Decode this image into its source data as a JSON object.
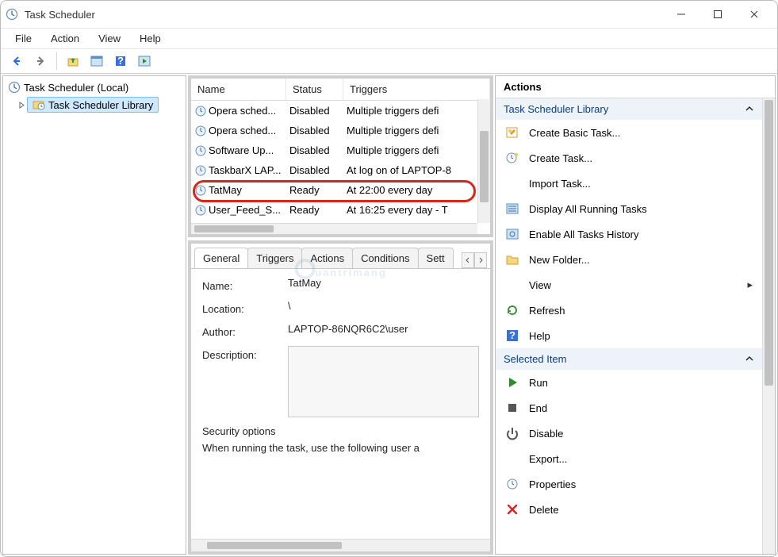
{
  "window": {
    "title": "Task Scheduler"
  },
  "menubar": {
    "file": "File",
    "action": "Action",
    "view": "View",
    "help": "Help"
  },
  "tree": {
    "root": "Task Scheduler (Local)",
    "library": "Task Scheduler Library"
  },
  "tasks": {
    "columns": {
      "name": "Name",
      "status": "Status",
      "triggers": "Triggers"
    },
    "rows": [
      {
        "name": "Opera sched...",
        "status": "Disabled",
        "triggers": "Multiple triggers defi"
      },
      {
        "name": "Opera sched...",
        "status": "Disabled",
        "triggers": "Multiple triggers defi"
      },
      {
        "name": "Software Up...",
        "status": "Disabled",
        "triggers": "Multiple triggers defi"
      },
      {
        "name": "TaskbarX LAP...",
        "status": "Disabled",
        "triggers": "At log on of LAPTOP-8"
      },
      {
        "name": "TatMay",
        "status": "Ready",
        "triggers": "At 22:00 every day"
      },
      {
        "name": "User_Feed_S...",
        "status": "Ready",
        "triggers": "At 16:25 every day - T"
      }
    ]
  },
  "details": {
    "tabs": {
      "general": "General",
      "triggers": "Triggers",
      "actions": "Actions",
      "conditions": "Conditions",
      "settings": "Sett"
    },
    "labels": {
      "name": "Name:",
      "location": "Location:",
      "author": "Author:",
      "description": "Description:"
    },
    "values": {
      "name": "TatMay",
      "location": "\\",
      "author": "LAPTOP-86NQR6C2\\user"
    },
    "security_header": "Security options",
    "security_line": "When running the task, use the following user a"
  },
  "actions": {
    "title": "Actions",
    "section_library": "Task Scheduler Library",
    "create_basic": "Create Basic Task...",
    "create_task": "Create Task...",
    "import_task": "Import Task...",
    "display_running": "Display All Running Tasks",
    "enable_history": "Enable All Tasks History",
    "new_folder": "New Folder...",
    "view": "View",
    "refresh": "Refresh",
    "help": "Help",
    "section_selected": "Selected Item",
    "run": "Run",
    "end": "End",
    "disable": "Disable",
    "export": "Export...",
    "properties": "Properties",
    "delete": "Delete"
  },
  "watermark": "uantrimang"
}
